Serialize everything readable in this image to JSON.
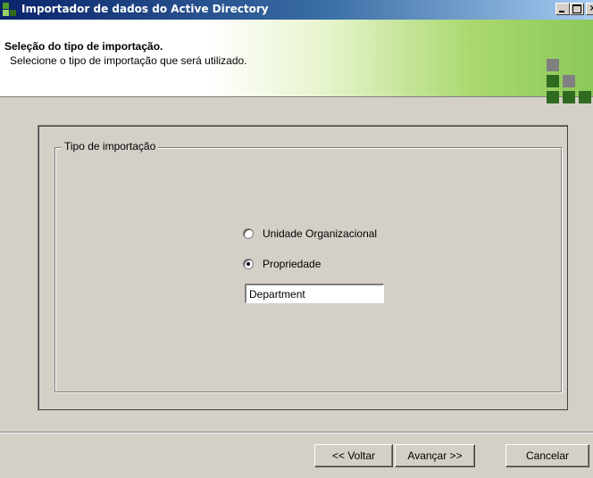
{
  "window": {
    "title": "Importador de dados do Active Directory",
    "buttons": {
      "minimize": "",
      "maximize": "",
      "close": "×"
    }
  },
  "header": {
    "title": "Seleção do tipo de importação.",
    "subtitle": "Selecione o tipo de importação que será utilizado."
  },
  "group": {
    "label": "Tipo de importação",
    "options": [
      {
        "label": "Unidade Organizacional",
        "checked": false
      },
      {
        "label": "Propriedade",
        "checked": true
      }
    ],
    "property_value": "Department"
  },
  "footer": {
    "back_label": "<< Voltar",
    "next_label": "Avançar >>",
    "cancel_label": "Cancelar"
  },
  "colors": {
    "titlebar_start": "#0a246a",
    "logo_dark": "#2e6b1f",
    "logo_mid": "#4e9a2a",
    "logo_gray": "#808080"
  },
  "icons": [
    "app-icon",
    "minimize-icon",
    "maximize-icon",
    "close-icon",
    "logo-icon"
  ]
}
